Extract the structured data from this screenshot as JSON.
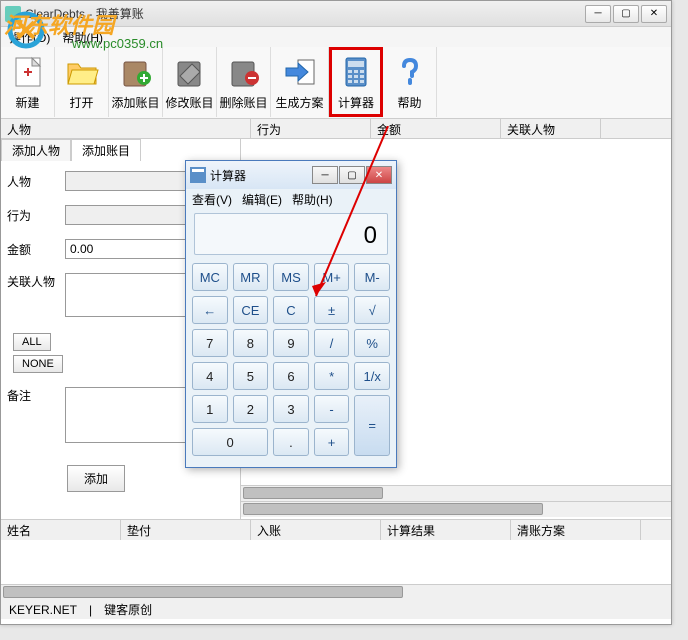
{
  "app": {
    "title": "ClearDebts - 我善算账",
    "menus": {
      "operation": "操作(O)",
      "help": "帮助(H)"
    }
  },
  "toolbar": {
    "new": "新建",
    "open": "打开",
    "add_account": "添加账目",
    "edit_account": "修改账目",
    "delete_account": "删除账目",
    "generate_plan": "生成方案",
    "calculator": "计算器",
    "help": "帮助"
  },
  "columns_upper": {
    "person": "人物",
    "action": "行为",
    "amount": "金额",
    "related_person": "关联人物"
  },
  "tabs": {
    "add_person": "添加人物",
    "add_account": "添加账目"
  },
  "form": {
    "person_label": "人物",
    "action_label": "行为",
    "amount_label": "金额",
    "amount_value": "0.00",
    "related_person_label": "关联人物",
    "all_btn": "ALL",
    "none_btn": "NONE",
    "remark_label": "备注",
    "add_btn": "添加"
  },
  "bottom_columns": {
    "name": "姓名",
    "advance": "垫付",
    "income": "入账",
    "calc_result": "计算结果",
    "clear_plan": "清账方案"
  },
  "status": {
    "site": "KEYER.NET",
    "author": "键客原创"
  },
  "watermark": {
    "text": "河东软件园",
    "url": "www.pc0359.cn"
  },
  "calc": {
    "title": "计算器",
    "menus": {
      "view": "查看(V)",
      "edit": "编辑(E)",
      "help": "帮助(H)"
    },
    "display": "0",
    "buttons": {
      "mc": "MC",
      "mr": "MR",
      "ms": "MS",
      "mplus": "M+",
      "mminus": "M-",
      "back": "←",
      "ce": "CE",
      "c": "C",
      "pm": "±",
      "sqrt": "√",
      "n7": "7",
      "n8": "8",
      "n9": "9",
      "div": "/",
      "pct": "%",
      "n4": "4",
      "n5": "5",
      "n6": "6",
      "mul": "*",
      "inv": "1/x",
      "n1": "1",
      "n2": "2",
      "n3": "3",
      "sub": "-",
      "eq": "=",
      "n0": "0",
      "dot": ".",
      "add": "+"
    }
  }
}
